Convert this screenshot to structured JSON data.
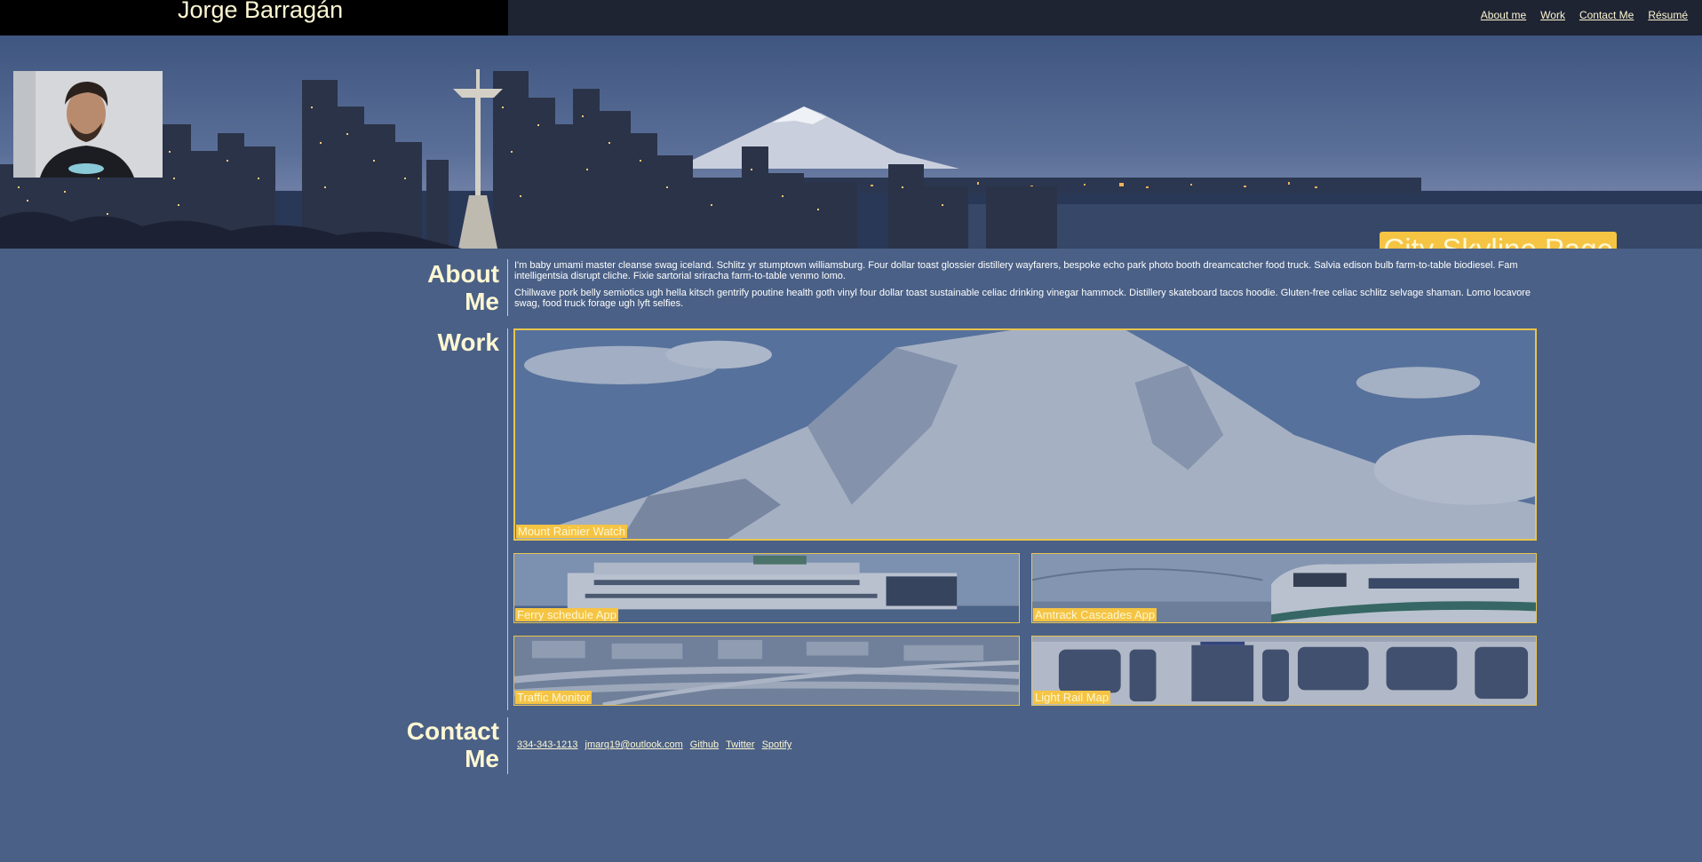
{
  "header": {
    "name": "Jorge Barragán",
    "nav": [
      "About me",
      "Work",
      "Contact Me",
      "Résumé"
    ]
  },
  "hero": {
    "title": "City Skyline Page"
  },
  "about": {
    "heading_line1": "About",
    "heading_line2": "Me",
    "paragraphs": [
      "I'm baby umami master cleanse swag iceland. Schlitz yr stumptown williamsburg. Four dollar toast glossier distillery wayfarers, bespoke echo park photo booth dreamcatcher food truck. Salvia edison bulb farm-to-table biodiesel. Fam intelligentsia disrupt cliche. Fixie sartorial sriracha farm-to-table venmo lomo.",
      "Chillwave pork belly semiotics ugh hella kitsch gentrify poutine health goth vinyl four dollar toast sustainable celiac drinking vinegar hammock. Distillery skateboard tacos hoodie. Gluten-free celiac schlitz selvage shaman. Lomo locavore swag, food truck forage ugh lyft selfies."
    ]
  },
  "work": {
    "heading": "Work",
    "projects": [
      "Mount Rainier Watch",
      "Ferry schedule App",
      "Amtrack Cascades App",
      "Traffic Monitor",
      "Light Rail Map"
    ]
  },
  "contact": {
    "heading_line1": "Contact",
    "heading_line2": "Me",
    "links": [
      "334-343-1213",
      "jmarq19@outlook.com",
      "Github",
      "Twitter",
      "Spotify"
    ]
  },
  "colors": {
    "page_bg": "#4a6086",
    "accent": "#f5c443",
    "text_cream": "#fdf7d3",
    "topbar": "#1f2433"
  }
}
